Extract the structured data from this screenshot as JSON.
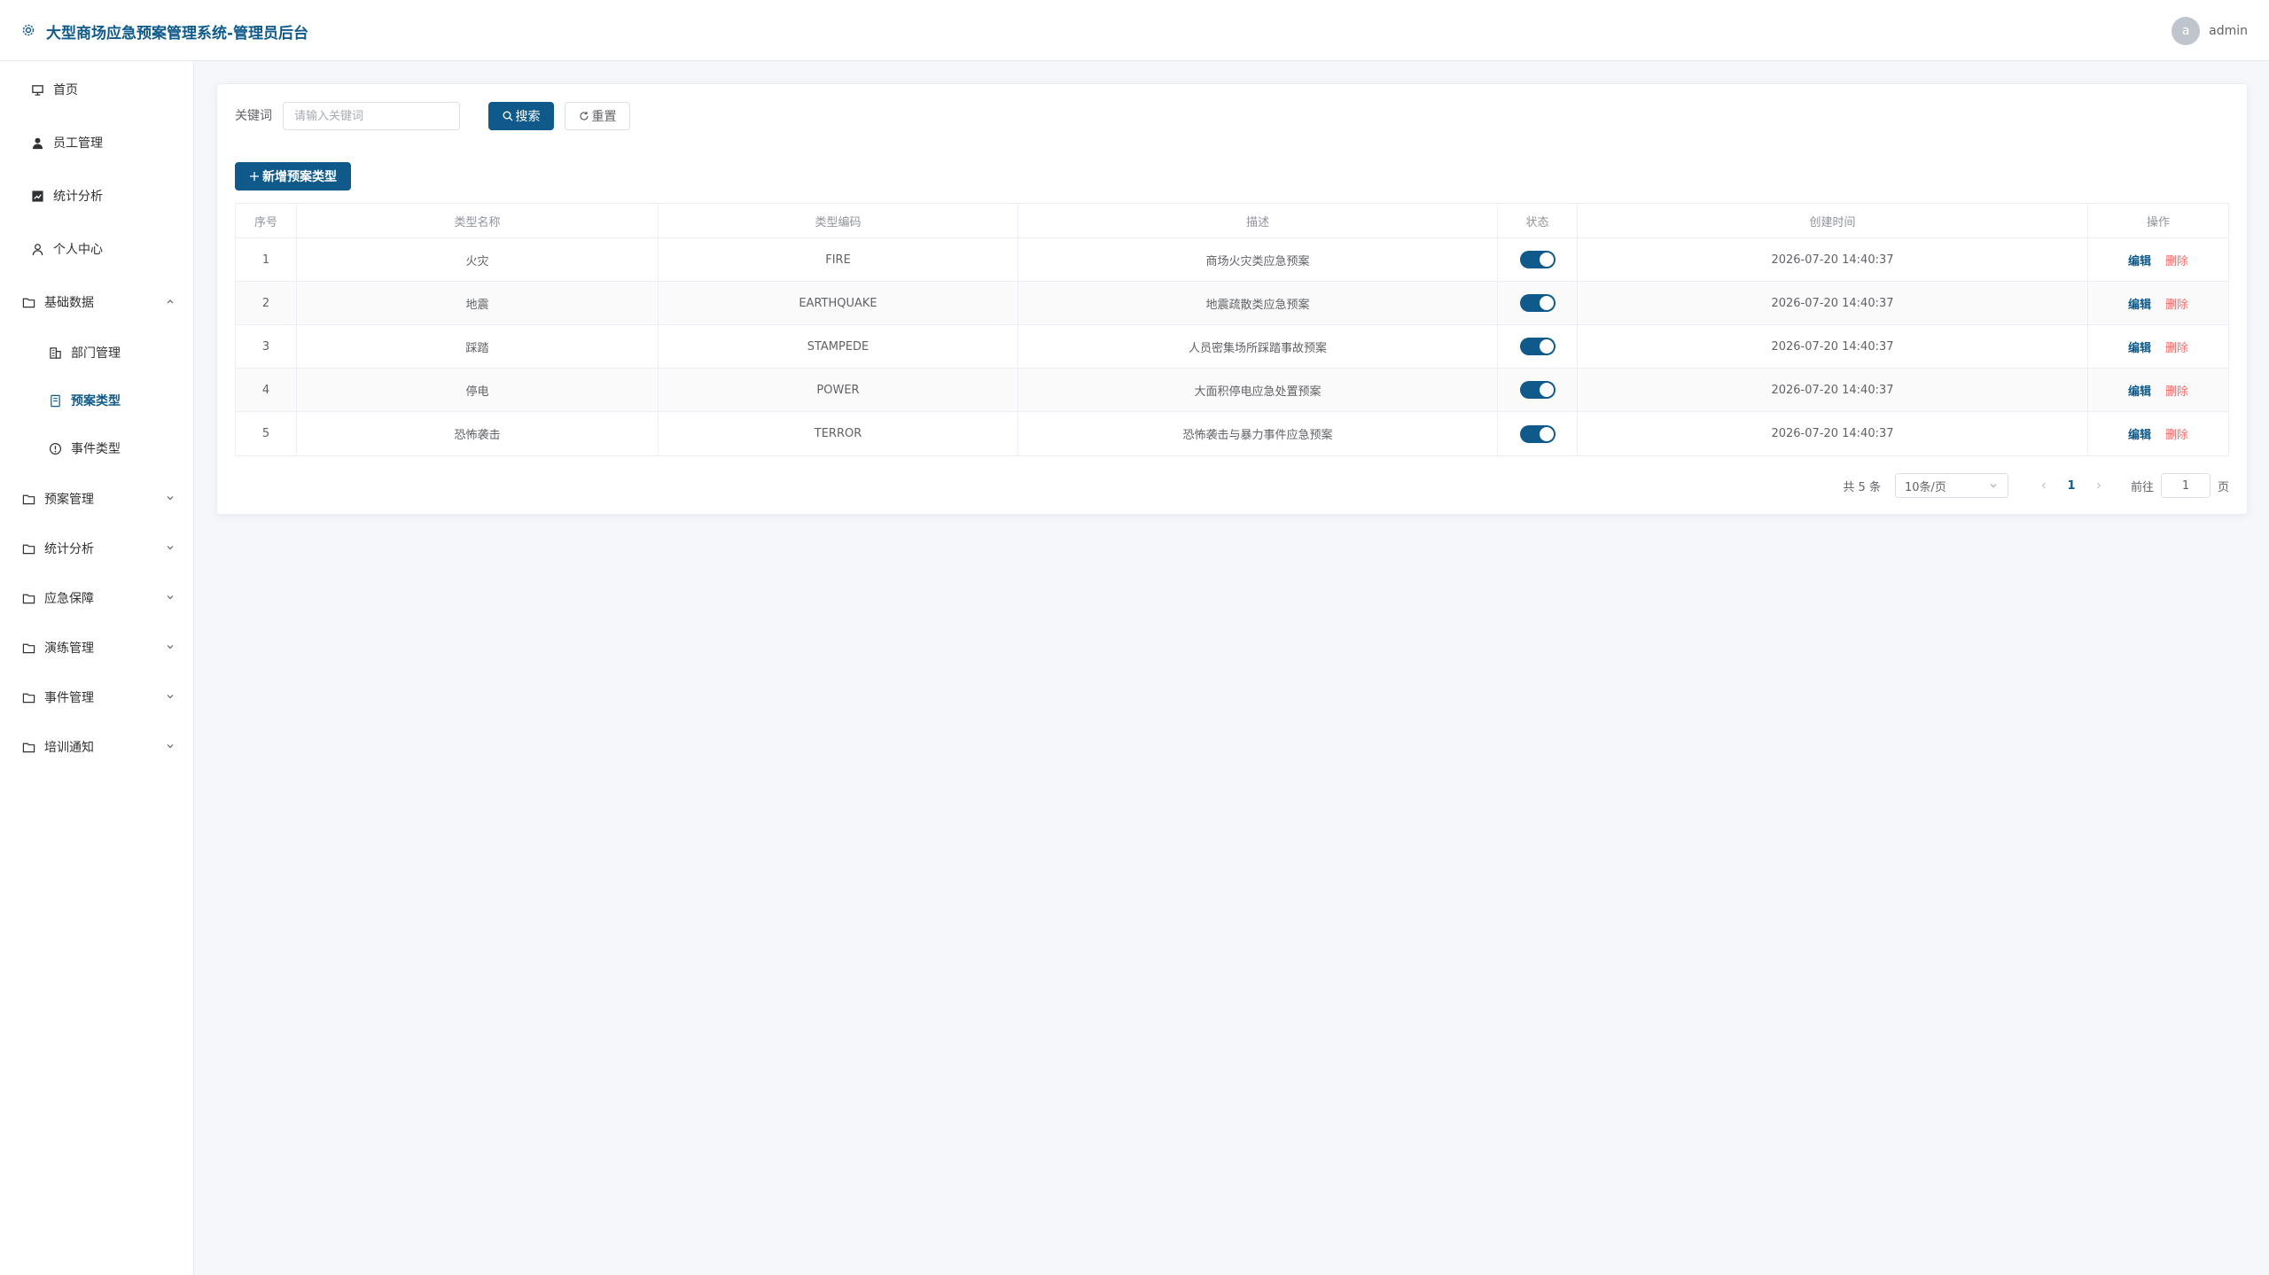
{
  "app": {
    "title": "大型商场应急预案管理系统-管理员后台",
    "user": {
      "avatar_letter": "a",
      "name": "admin"
    }
  },
  "sidebar": {
    "items": [
      {
        "label": "首页",
        "icon": "home-icon"
      },
      {
        "label": "员工管理",
        "icon": "user-icon"
      },
      {
        "label": "统计分析",
        "icon": "chart-icon"
      },
      {
        "label": "个人中心",
        "icon": "user-outline-icon"
      },
      {
        "label": "基础数据",
        "icon": "folder-icon",
        "expanded": true,
        "children": [
          {
            "label": "部门管理",
            "icon": "building-icon"
          },
          {
            "label": "预案类型",
            "icon": "document-icon",
            "active": true
          },
          {
            "label": "事件类型",
            "icon": "warning-icon"
          }
        ]
      },
      {
        "label": "预案管理",
        "icon": "folder-icon"
      },
      {
        "label": "统计分析",
        "icon": "folder-icon"
      },
      {
        "label": "应急保障",
        "icon": "folder-icon"
      },
      {
        "label": "演练管理",
        "icon": "folder-icon"
      },
      {
        "label": "事件管理",
        "icon": "folder-icon"
      },
      {
        "label": "培训通知",
        "icon": "folder-icon"
      }
    ]
  },
  "search": {
    "label": "关键词",
    "placeholder": "请输入关键词",
    "value": "",
    "search_button": "搜索",
    "reset_button": "重置"
  },
  "add_button": "新增预案类型",
  "table": {
    "columns": [
      "序号",
      "类型名称",
      "类型编码",
      "描述",
      "状态",
      "创建时间",
      "操作"
    ],
    "rows": [
      {
        "index": "1",
        "name": "火灾",
        "code": "FIRE",
        "desc": "商场火灾类应急预案",
        "enabled": true,
        "created": "2026-07-20 14:40:37"
      },
      {
        "index": "2",
        "name": "地震",
        "code": "EARTHQUAKE",
        "desc": "地震疏散类应急预案",
        "enabled": true,
        "created": "2026-07-20 14:40:37"
      },
      {
        "index": "3",
        "name": "踩踏",
        "code": "STAMPEDE",
        "desc": "人员密集场所踩踏事故预案",
        "enabled": true,
        "created": "2026-07-20 14:40:37"
      },
      {
        "index": "4",
        "name": "停电",
        "code": "POWER",
        "desc": "大面积停电应急处置预案",
        "enabled": true,
        "created": "2026-07-20 14:40:37"
      },
      {
        "index": "5",
        "name": "恐怖袭击",
        "code": "TERROR",
        "desc": "恐怖袭击与暴力事件应急预案",
        "enabled": true,
        "created": "2026-07-20 14:40:37"
      }
    ],
    "actions": {
      "edit": "编辑",
      "delete": "删除"
    }
  },
  "pagination": {
    "total_text": "共 5 条",
    "page_size": "10条/页",
    "current_page": "1",
    "goto_label": "前往",
    "goto_value": "1",
    "page_suffix": "页"
  },
  "colors": {
    "primary": "#0f5a8a",
    "danger": "#f56c6c"
  }
}
